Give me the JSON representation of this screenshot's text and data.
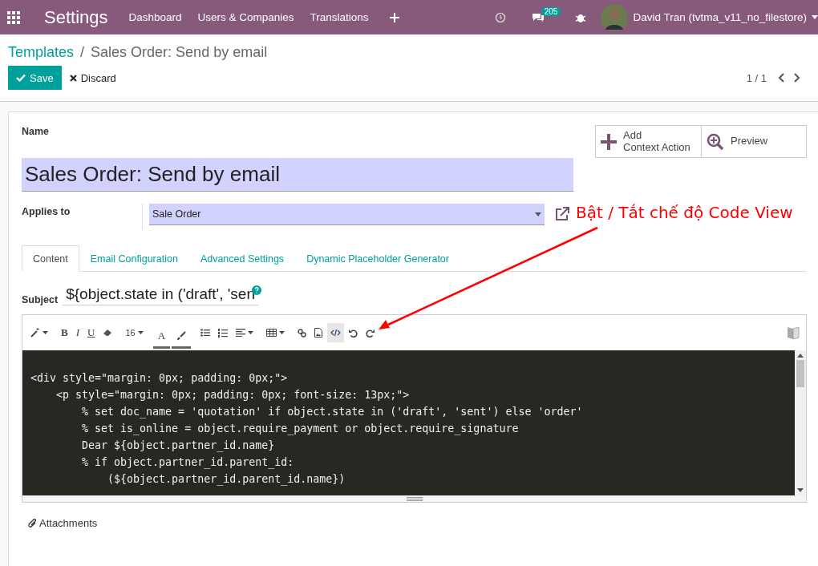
{
  "navbar": {
    "app_title": "Settings",
    "menu": [
      "Dashboard",
      "Users & Companies",
      "Translations"
    ],
    "messages_count": "205",
    "user": "David Tran (tvtma_v11_no_filestore)"
  },
  "breadcrumb": {
    "parent": "Templates",
    "separator": "/",
    "current": "Sales Order: Send by email"
  },
  "actions": {
    "save": "Save",
    "discard": "Discard",
    "pager": "1 / 1"
  },
  "smart_buttons": [
    {
      "kind": "add",
      "label": "Add\nContext Action"
    },
    {
      "kind": "preview",
      "label": "Preview"
    }
  ],
  "name_label": "Name",
  "name_value": "Sales Order: Send by email",
  "applies_to": {
    "label": "Applies to",
    "value": "Sale Order"
  },
  "tabs": [
    {
      "label": "Content",
      "selected": true
    },
    {
      "label": "Email Configuration",
      "selected": false
    },
    {
      "label": "Advanced Settings",
      "selected": false
    },
    {
      "label": "Dynamic Placeholder Generator",
      "selected": false
    }
  ],
  "subject": {
    "label": "Subject",
    "value": "${object.state in ('draft', 'sen"
  },
  "toolbar": [
    {
      "kind": "magic",
      "selected": false
    },
    {
      "kind": "bold",
      "label": "B",
      "selected": false
    },
    {
      "kind": "italic",
      "label": "I",
      "selected": false
    },
    {
      "kind": "underline",
      "label": "U",
      "selected": false
    },
    {
      "kind": "eraser",
      "selected": false
    },
    {
      "kind": "size",
      "label": "16",
      "selected": false
    },
    {
      "kind": "color",
      "label": "A",
      "selected": false
    },
    {
      "kind": "highlight",
      "selected": false
    },
    {
      "kind": "ul",
      "selected": false
    },
    {
      "kind": "ol",
      "selected": false
    },
    {
      "kind": "align",
      "selected": false
    },
    {
      "kind": "table",
      "selected": false
    },
    {
      "kind": "link",
      "selected": false
    },
    {
      "kind": "image",
      "selected": false
    },
    {
      "kind": "code",
      "selected": true
    },
    {
      "kind": "undo",
      "selected": false
    },
    {
      "kind": "redo",
      "selected": false
    }
  ],
  "code_lines": [
    "<div style=\"margin: 0px; padding: 0px;\">",
    "    <p style=\"margin: 0px; padding: 0px; font-size: 13px;\">",
    "        % set doc_name = 'quotation' if object.state in ('draft', 'sent') else 'order'",
    "        % set is_online = object.require_payment or object.require_signature",
    "        Dear ${object.partner_id.name}",
    "        % if object.partner_id.parent_id:",
    "            (${object.partner_id.parent_id.name})"
  ],
  "attachments": "Attachments",
  "annotation": "Bật / Tắt chế độ Code View"
}
